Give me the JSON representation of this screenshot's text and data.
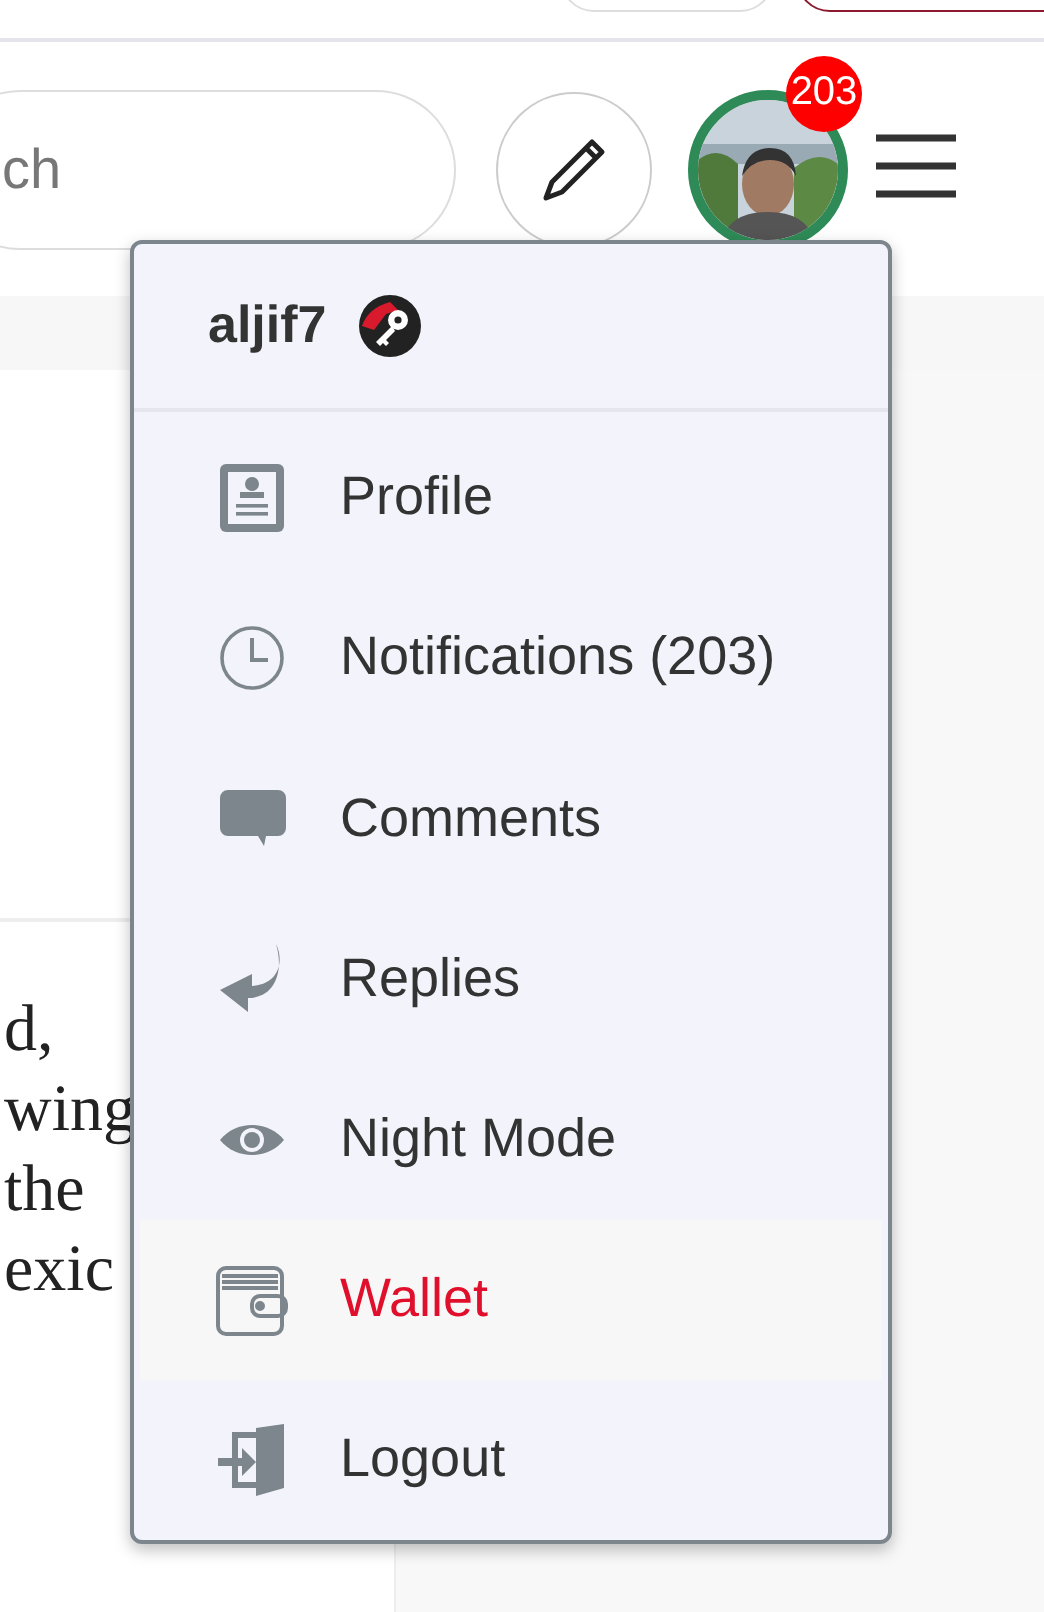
{
  "search": {
    "placeholder": "ch"
  },
  "account": {
    "notification_count": "203",
    "online": true
  },
  "article_fragments": [
    "d,",
    "wing",
    "the",
    "exic"
  ],
  "menu": {
    "username": "aljif7",
    "items": [
      {
        "label": "Profile",
        "kind": "profile",
        "selected": false
      },
      {
        "label": "Notifications (203)",
        "kind": "notifications",
        "selected": false
      },
      {
        "label": "Comments",
        "kind": "comments",
        "selected": false
      },
      {
        "label": "Replies",
        "kind": "replies",
        "selected": false
      },
      {
        "label": "Night Mode",
        "kind": "night",
        "selected": false
      },
      {
        "label": "Wallet",
        "kind": "wallet",
        "selected": true
      },
      {
        "label": "Logout",
        "kind": "logout",
        "selected": false
      }
    ]
  }
}
